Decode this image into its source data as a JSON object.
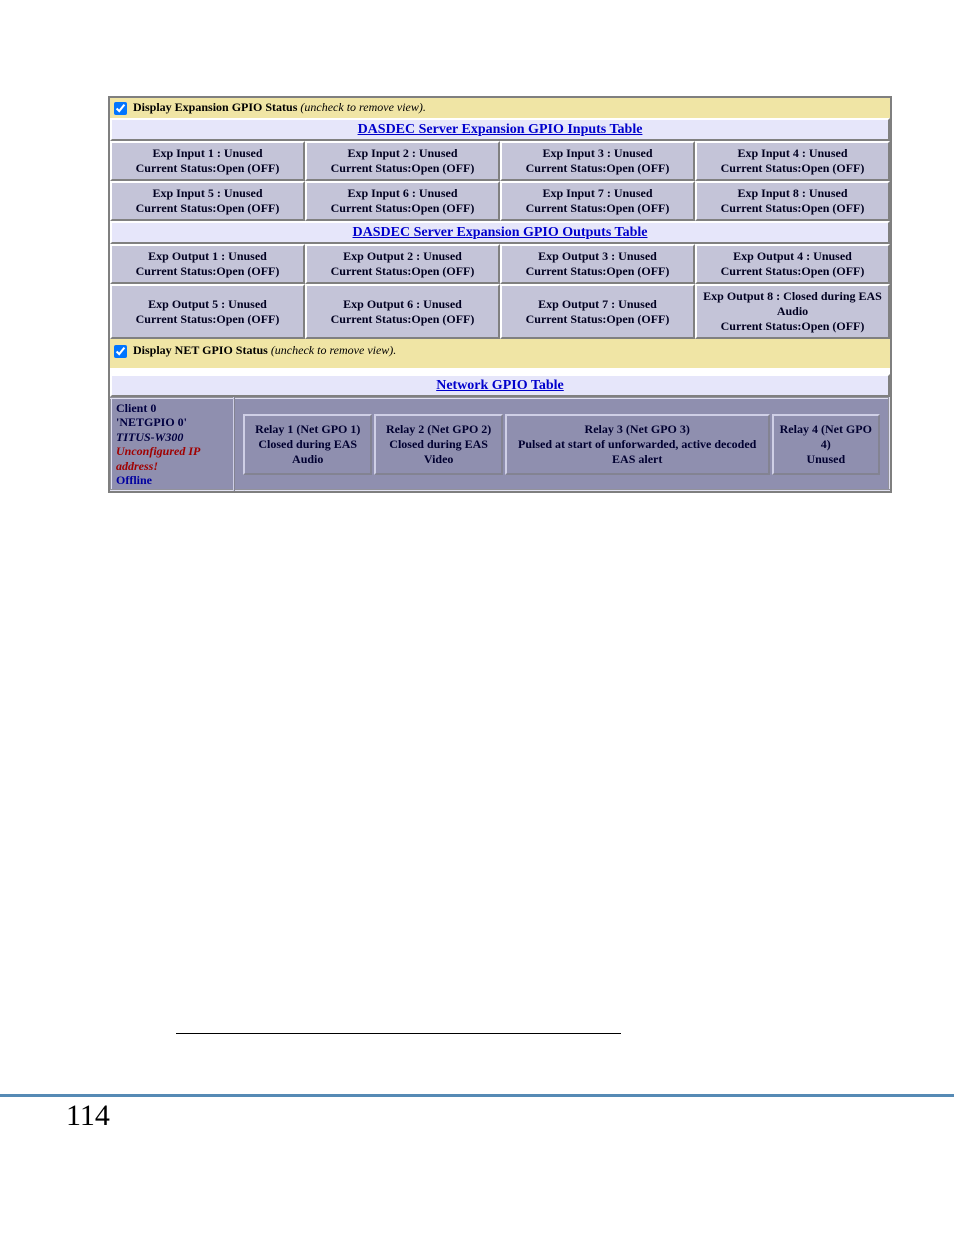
{
  "expGpio": {
    "checkboxLabel": "Display Expansion GPIO Status",
    "checkboxHint": "(uncheck to remove view).",
    "inputsHeader": "DASDEC Server Expansion GPIO Inputs Table",
    "outputsHeader": "DASDEC Server Expansion GPIO Outputs Table",
    "inputs": [
      {
        "l1": "Exp Input 1 : Unused",
        "l2": "Current Status:Open (OFF)"
      },
      {
        "l1": "Exp Input 2 : Unused",
        "l2": "Current Status:Open (OFF)"
      },
      {
        "l1": "Exp Input 3 : Unused",
        "l2": "Current Status:Open (OFF)"
      },
      {
        "l1": "Exp Input 4 : Unused",
        "l2": "Current Status:Open (OFF)"
      },
      {
        "l1": "Exp Input 5 : Unused",
        "l2": "Current Status:Open (OFF)"
      },
      {
        "l1": "Exp Input 6 : Unused",
        "l2": "Current Status:Open (OFF)"
      },
      {
        "l1": "Exp Input 7 : Unused",
        "l2": "Current Status:Open (OFF)"
      },
      {
        "l1": "Exp Input 8 : Unused",
        "l2": "Current Status:Open (OFF)"
      }
    ],
    "outputs": [
      {
        "l1": "Exp Output 1 : Unused",
        "l2": "Current Status:Open (OFF)"
      },
      {
        "l1": "Exp Output 2 : Unused",
        "l2": "Current Status:Open (OFF)"
      },
      {
        "l1": "Exp Output 3 : Unused",
        "l2": "Current Status:Open (OFF)"
      },
      {
        "l1": "Exp Output 4 : Unused",
        "l2": "Current Status:Open (OFF)"
      },
      {
        "l1": "Exp Output 5 : Unused",
        "l2": "Current Status:Open (OFF)"
      },
      {
        "l1": "Exp Output 6 : Unused",
        "l2": "Current Status:Open (OFF)"
      },
      {
        "l1": "Exp Output 7 : Unused",
        "l2": "Current Status:Open (OFF)"
      },
      {
        "l1": "Exp Output 8 : Closed during EAS Audio",
        "l2": "Current Status:Open (OFF)"
      }
    ]
  },
  "netGpio": {
    "checkboxLabel": "Display NET GPIO Status",
    "checkboxHint": "(uncheck to remove view).",
    "header": "Network GPIO Table",
    "client": {
      "title": "Client 0",
      "name": "'NETGPIO 0'",
      "model": "TITUS-W300",
      "warn": "Unconfigured IP address!",
      "state": "Offline"
    },
    "relays": [
      {
        "t": "Relay 1 (Net GPO 1)",
        "d": "Closed during EAS Audio"
      },
      {
        "t": "Relay 2 (Net GPO 2)",
        "d": "Closed during EAS Video"
      },
      {
        "t": "Relay 3 (Net GPO 3)",
        "d": "Pulsed at start of unforwarded, active decoded EAS alert"
      },
      {
        "t": "Relay 4 (Net GPO 4)",
        "d": "Unused"
      }
    ]
  },
  "pageNumber": "114"
}
